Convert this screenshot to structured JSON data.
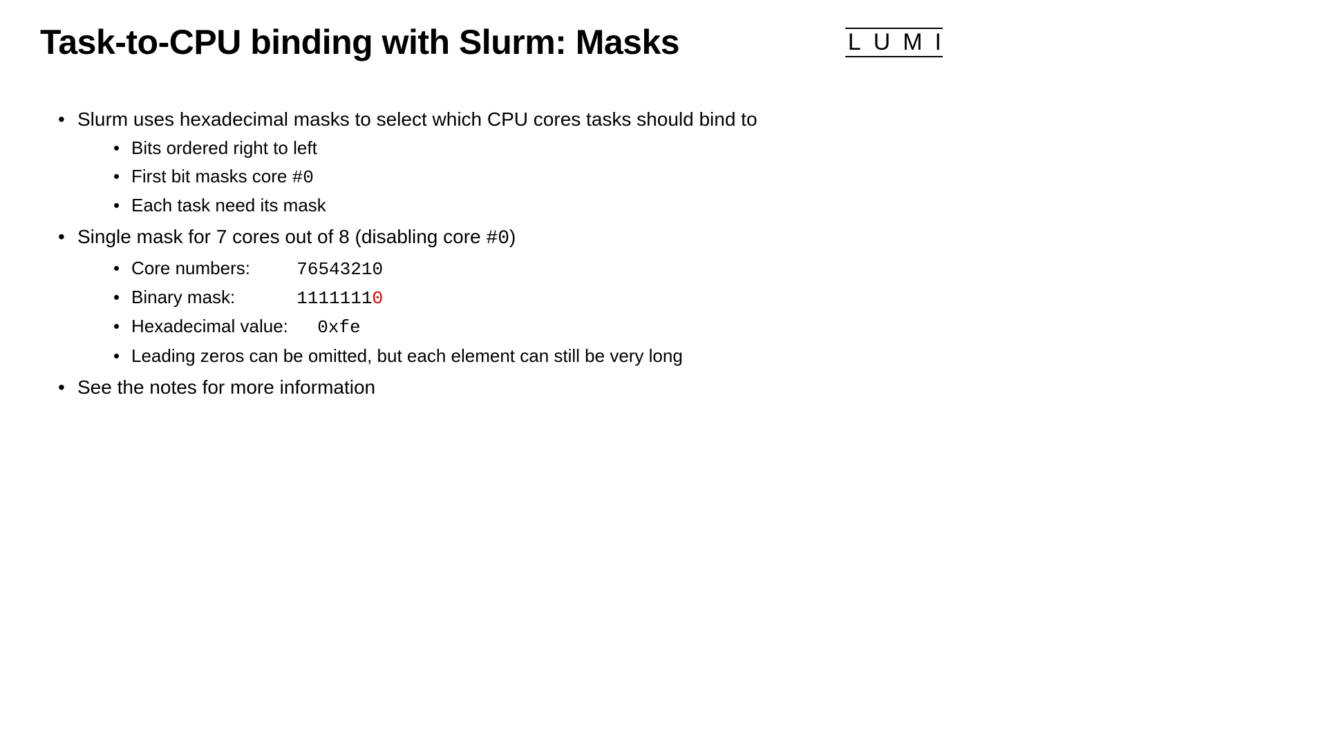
{
  "header": {
    "title": "Task-to-CPU binding with Slurm: Masks",
    "logo": "LUMI"
  },
  "bullets": {
    "item1": "Slurm uses hexadecimal masks to select which CPU cores  tasks should bind to",
    "item1_sub1": "Bits ordered right to left",
    "item1_sub2_pre": "First bit masks core ",
    "item1_sub2_mono": "#0",
    "item1_sub3": "Each task need its mask",
    "item2_pre": "Single mask for 7 cores out of 8 (disabling core ",
    "item2_mono": "#0",
    "item2_post": ")",
    "item2_sub1_label": "Core numbers:",
    "item2_sub1_value": "76543210",
    "item2_sub2_label": "Binary mask:",
    "item2_sub2_value_main": "1111111",
    "item2_sub2_value_red": "0",
    "item2_sub3_label": "Hexadecimal value:",
    "item2_sub3_value": "0xfe",
    "item2_sub4": "Leading zeros can be omitted, but each element can still be very long",
    "item3": "See the notes for more information"
  }
}
